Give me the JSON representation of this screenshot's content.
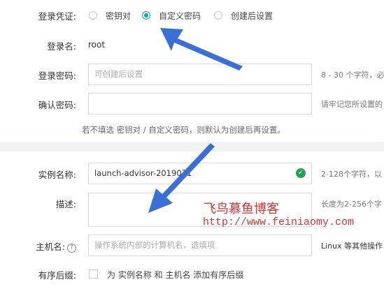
{
  "login_credential": {
    "label": "登录凭证:",
    "options": [
      {
        "label": "密钥对",
        "checked": false
      },
      {
        "label": "自定义密码",
        "checked": true
      },
      {
        "label": "创建后设置",
        "checked": false
      }
    ]
  },
  "login_name": {
    "label": "登录名:",
    "value": "root"
  },
  "login_password": {
    "label": "登录密码:",
    "placeholder": "可创建后设置",
    "hint": "8 - 30 个字符，必"
  },
  "confirm_password": {
    "label": "确认密码:",
    "hint": "请牢记您所设置的"
  },
  "password_note": "若不填选 密钥对 / 自定义密码，则默认为创建后再设置。",
  "instance_name": {
    "label": "实例名称:",
    "value": "launch-advisor-2019071",
    "hint": "2-128个字符，以"
  },
  "description": {
    "label": "描述:",
    "hint": "长度为2-256个字"
  },
  "hostname": {
    "label": "主机名:",
    "placeholder": "操作系统内部的计算机名，选填项",
    "hint": "Linux 等其他操作"
  },
  "ordered_suffix": {
    "label": "有序后缀:",
    "text": "为 实例名称 和 主机名 添加有序后缀"
  },
  "watermark": {
    "title": "飞鸟慕鱼博客",
    "url": "http://www.feiniaomy.com"
  },
  "colors": {
    "accent": "#00a1d6",
    "success": "#22a550",
    "arrow": "#3a6fd8",
    "watermark": "#d93030"
  }
}
